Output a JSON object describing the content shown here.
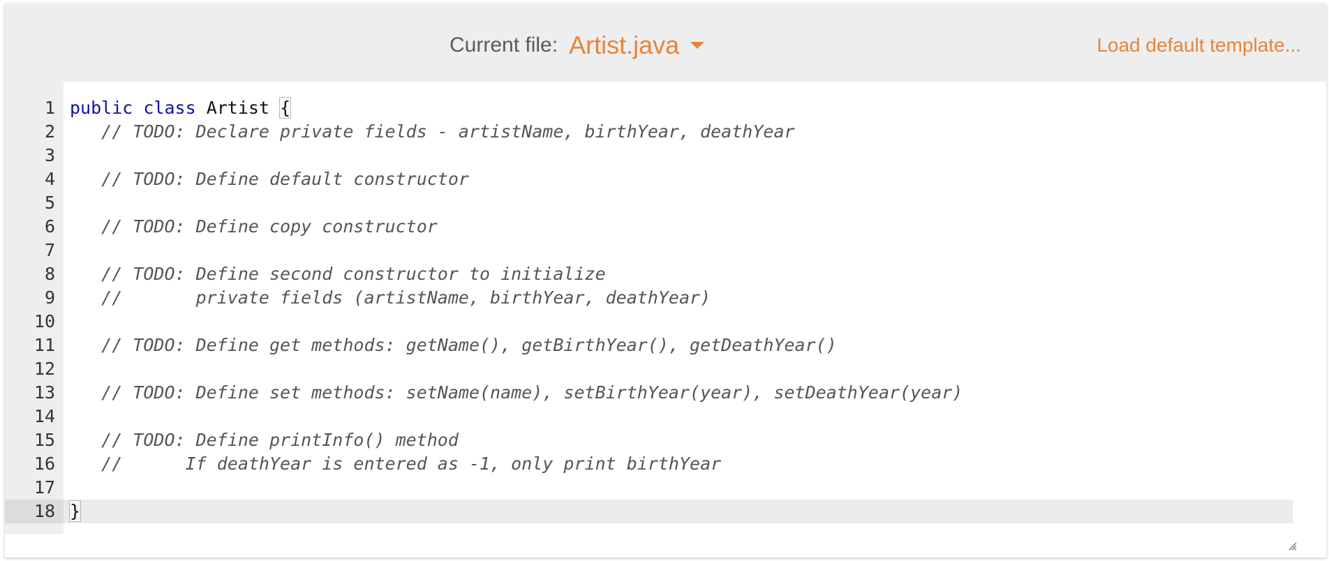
{
  "header": {
    "current_file_label": "Current file:",
    "file_name": "Artist.java",
    "load_template_label": "Load default template..."
  },
  "editor": {
    "active_line": 18,
    "lines": [
      {
        "num": "1",
        "parts": [
          {
            "t": "kw",
            "s": "public"
          },
          {
            "t": "tx",
            "s": " "
          },
          {
            "t": "kw",
            "s": "class"
          },
          {
            "t": "tx",
            "s": " Artist "
          },
          {
            "t": "brace",
            "s": "{"
          }
        ]
      },
      {
        "num": "2",
        "parts": [
          {
            "t": "tx",
            "s": "   "
          },
          {
            "t": "cm",
            "s": "// TODO: Declare private fields - artistName, birthYear, deathYear"
          }
        ]
      },
      {
        "num": "3",
        "parts": []
      },
      {
        "num": "4",
        "parts": [
          {
            "t": "tx",
            "s": "   "
          },
          {
            "t": "cm",
            "s": "// TODO: Define default constructor"
          }
        ]
      },
      {
        "num": "5",
        "parts": []
      },
      {
        "num": "6",
        "parts": [
          {
            "t": "tx",
            "s": "   "
          },
          {
            "t": "cm",
            "s": "// TODO: Define copy constructor"
          }
        ]
      },
      {
        "num": "7",
        "parts": []
      },
      {
        "num": "8",
        "parts": [
          {
            "t": "tx",
            "s": "   "
          },
          {
            "t": "cm",
            "s": "// TODO: Define second constructor to initialize"
          }
        ]
      },
      {
        "num": "9",
        "parts": [
          {
            "t": "tx",
            "s": "   "
          },
          {
            "t": "cm",
            "s": "//       private fields (artistName, birthYear, deathYear)"
          }
        ]
      },
      {
        "num": "10",
        "parts": []
      },
      {
        "num": "11",
        "parts": [
          {
            "t": "tx",
            "s": "   "
          },
          {
            "t": "cm",
            "s": "// TODO: Define get methods: getName(), getBirthYear(), getDeathYear()"
          }
        ]
      },
      {
        "num": "12",
        "parts": []
      },
      {
        "num": "13",
        "parts": [
          {
            "t": "tx",
            "s": "   "
          },
          {
            "t": "cm",
            "s": "// TODO: Define set methods: setName(name), setBirthYear(year), setDeathYear(year)"
          }
        ]
      },
      {
        "num": "14",
        "parts": []
      },
      {
        "num": "15",
        "parts": [
          {
            "t": "tx",
            "s": "   "
          },
          {
            "t": "cm",
            "s": "// TODO: Define printInfo() method"
          }
        ]
      },
      {
        "num": "16",
        "parts": [
          {
            "t": "tx",
            "s": "   "
          },
          {
            "t": "cm",
            "s": "//      If deathYear is entered as -1, only print birthYear"
          }
        ]
      },
      {
        "num": "17",
        "parts": []
      },
      {
        "num": "18",
        "parts": [
          {
            "t": "brace",
            "s": "}"
          }
        ]
      }
    ]
  },
  "colors": {
    "accent": "#e8843a",
    "keyword": "#1010a8",
    "comment": "#555555",
    "gutter": "#eeeeee"
  },
  "icons": {
    "dropdown": "caret-down-icon",
    "resize": "resize-handle-icon"
  }
}
